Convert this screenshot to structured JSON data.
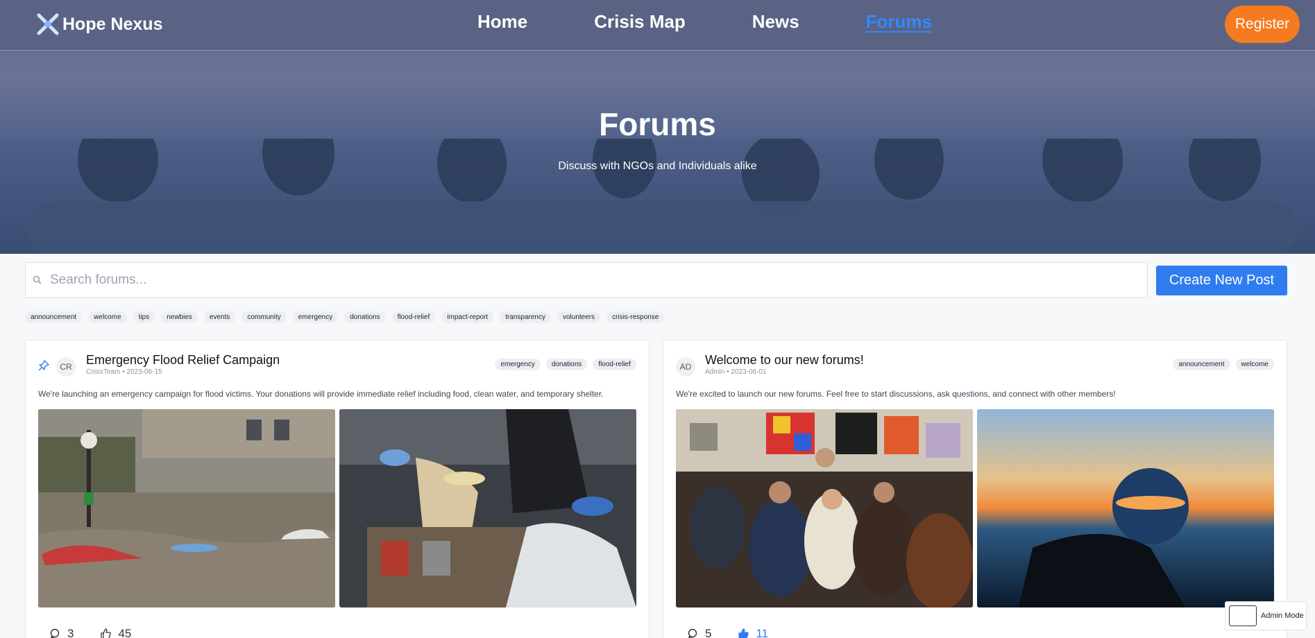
{
  "brand": {
    "name": "Hope Nexus"
  },
  "nav": {
    "links": [
      {
        "label": "Home",
        "active": false
      },
      {
        "label": "Crisis Map",
        "active": false
      },
      {
        "label": "News",
        "active": false
      },
      {
        "label": "Forums",
        "active": true
      }
    ],
    "register_label": "Register"
  },
  "hero": {
    "title": "Forums",
    "subtitle": "Discuss with NGOs and Individuals alike"
  },
  "search": {
    "placeholder": "Search forums...",
    "value": ""
  },
  "create_post_label": "Create New Post",
  "tag_filters": [
    "announcement",
    "welcome",
    "tips",
    "newbies",
    "events",
    "community",
    "emergency",
    "donations",
    "flood-relief",
    "impact-report",
    "transparency",
    "volunteers",
    "crisis-response"
  ],
  "posts": [
    {
      "pinned": true,
      "avatar": "CR",
      "title": "Emergency Flood Relief Campaign",
      "meta": "CrisisTeam • 2023-06-15",
      "tags": [
        "emergency",
        "donations",
        "flood-relief"
      ],
      "excerpt": "We're launching an emergency campaign for flood victims. Your donations will provide immediate relief including food, clean water, and temporary shelter.",
      "comments": "3",
      "likes": "45",
      "liked": false
    },
    {
      "pinned": false,
      "avatar": "AD",
      "title": "Welcome to our new forums!",
      "meta": "Admin • 2023-06-01",
      "tags": [
        "announcement",
        "welcome"
      ],
      "excerpt": "We're excited to launch our new forums. Feel free to start discussions, ask questions, and connect with other members!",
      "comments": "5",
      "likes": "11",
      "liked": true
    }
  ],
  "admin_mode_label": "Admin Mode",
  "colors": {
    "nav_bg": "#5a6384",
    "accent": "#2f7cf0",
    "register": "#f67a1f"
  }
}
